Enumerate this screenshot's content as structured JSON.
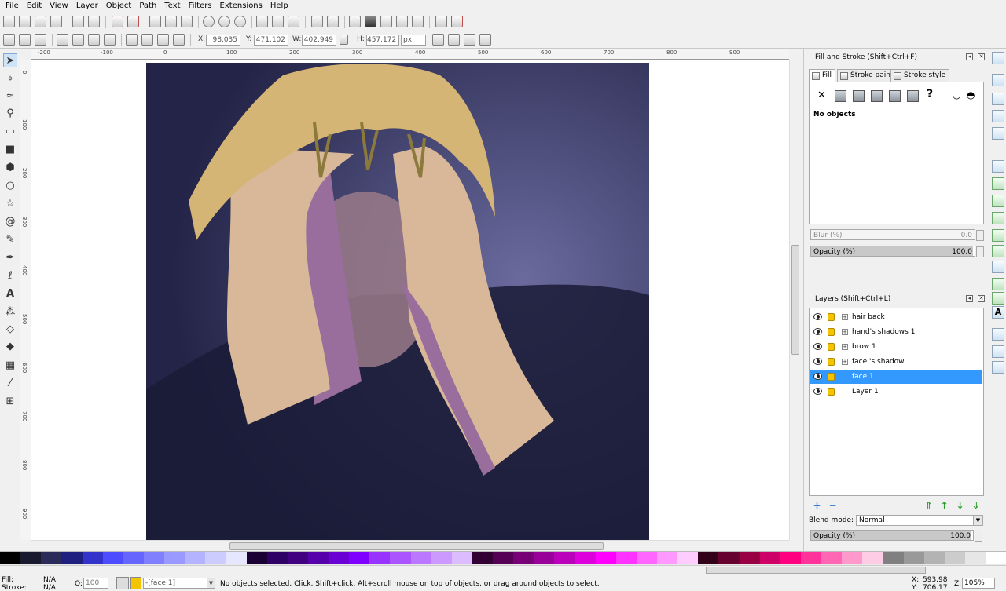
{
  "menu": [
    {
      "label": "File",
      "accel": "F",
      "rest": "ile"
    },
    {
      "label": "Edit",
      "accel": "E",
      "rest": "dit"
    },
    {
      "label": "View",
      "accel": "V",
      "rest": "iew"
    },
    {
      "label": "Layer",
      "accel": "L",
      "rest": "ayer"
    },
    {
      "label": "Object",
      "accel": "O",
      "rest": "bject"
    },
    {
      "label": "Path",
      "accel": "P",
      "rest": "ath"
    },
    {
      "label": "Text",
      "accel": "T",
      "rest": "ext"
    },
    {
      "label": "Filters",
      "accel": "F",
      "rest": "ilters"
    },
    {
      "label": "Extensions",
      "accel": "E",
      "rest": "xtensions"
    },
    {
      "label": "Help",
      "accel": "H",
      "rest": "elp"
    }
  ],
  "toolcontrols": {
    "x_label": "X:",
    "x_value": "98.035",
    "y_label": "Y:",
    "y_value": "471.102",
    "w_label": "W:",
    "w_value": "402.949",
    "h_label": "H:",
    "h_value": "457.172",
    "unit": "px"
  },
  "ruler_top_labels": [
    "-200",
    "-100",
    "0",
    "100",
    "200",
    "300",
    "400",
    "500",
    "600",
    "700",
    "800",
    "900"
  ],
  "ruler_left_labels": [
    "0",
    "100",
    "200",
    "300",
    "400",
    "500",
    "600",
    "700",
    "800",
    "900"
  ],
  "fill_stroke": {
    "title": "Fill and Stroke (Shift+Ctrl+F)",
    "tab_fill": "Fill",
    "tab_stroke_paint": "Stroke paint",
    "tab_stroke_style": "Stroke style",
    "no_paint_symbol": "✕",
    "unset_symbol": "?",
    "no_objects": "No objects",
    "blur_label": "Blur (%)",
    "blur_value": "0.0",
    "opacity_label": "Opacity (%)",
    "opacity_value": "100.0"
  },
  "layers_panel": {
    "title": "Layers (Shift+Ctrl+L)",
    "layers": [
      {
        "name": "hair back",
        "has_children": true,
        "selected": false
      },
      {
        "name": "hand's shadows 1",
        "has_children": true,
        "selected": false
      },
      {
        "name": "brow 1",
        "has_children": true,
        "selected": false
      },
      {
        "name": "face 's shadow",
        "has_children": true,
        "selected": false
      },
      {
        "name": "face 1",
        "has_children": false,
        "selected": true
      },
      {
        "name": "Layer 1",
        "has_children": false,
        "selected": false
      }
    ],
    "expander_symbol": "+",
    "blend_label": "Blend mode:",
    "blend_value": "Normal",
    "opacity_label": "Opacity (%)",
    "opacity_value": "100.0"
  },
  "colors": {
    "selection": "#3399ff",
    "bg_dark": "#232447",
    "bg_light": "#6a6a9e",
    "skin": "#d8b898",
    "shadow": "#9a6e9c",
    "hair": "#d4b576",
    "hair_shadow": "#8c7a3c"
  },
  "palette_colors": [
    "#000000",
    "#1a1a2e",
    "#2b2b5a",
    "#1f1f80",
    "#3333cc",
    "#4d4dff",
    "#6666ff",
    "#8080ff",
    "#9999ff",
    "#b3b3ff",
    "#ccccff",
    "#e6e6ff",
    "#1a0033",
    "#2e0066",
    "#400080",
    "#5500aa",
    "#6a00d4",
    "#7f00ff",
    "#9933ff",
    "#aa55ff",
    "#bb77ff",
    "#cc99ff",
    "#ddbbff",
    "#330033",
    "#550055",
    "#770077",
    "#990099",
    "#bb00bb",
    "#dd00dd",
    "#ff00ff",
    "#ff33ff",
    "#ff66ff",
    "#ff99ff",
    "#ffccff",
    "#33001a",
    "#66002e",
    "#990044",
    "#cc0066",
    "#ff0080",
    "#ff3399",
    "#ff66b3",
    "#ff99cc",
    "#ffcce6",
    "#808080",
    "#999999",
    "#b3b3b3",
    "#cccccc",
    "#e6e6e6",
    "#ffffff"
  ],
  "status": {
    "fill_label": "Fill:",
    "fill_value": "N/A",
    "stroke_label": "Stroke:",
    "stroke_value": "N/A",
    "o_label": "O:",
    "o_value": "100",
    "layer_value": "-[face 1]",
    "message": "No objects selected. Click, Shift+click, Alt+scroll mouse on top of objects, or drag around objects to select.",
    "x_label": "X:",
    "x_value": "593.98",
    "y_label": "Y:",
    "y_value": "706.17",
    "z_label": "Z:",
    "z_value": "105%"
  }
}
